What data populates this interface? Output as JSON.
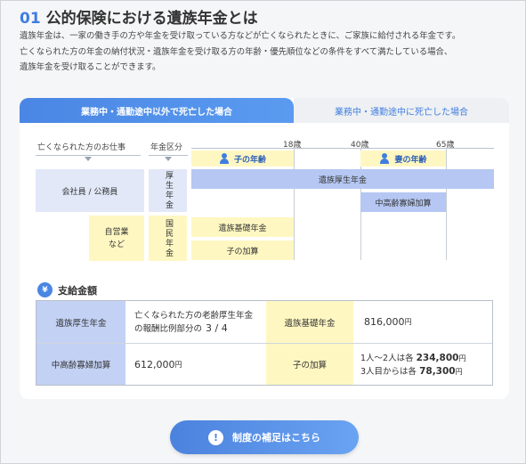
{
  "section": {
    "number": "01",
    "title": "公的保険における遺族年金とは",
    "intro_lines": [
      "遺族年金は、一家の働き手の方や年金を受け取っている方などが亡くなられたときに、ご家族に給付される年金です。",
      "亡くなられた方の年金の納付状況・遺族年金を受け取る方の年齢・優先順位などの条件をすべて満たしている場合、",
      "遺族年金を受け取ることができます。"
    ]
  },
  "tabs": [
    {
      "label": "業務中・通勤途中以外で死亡した場合",
      "active": true
    },
    {
      "label": "業務中・通勤途中に死亡した場合",
      "active": false
    }
  ],
  "diagram": {
    "col_occupation": "亡くなられた方のお仕事",
    "col_pension_type": "年金区分",
    "ages": [
      "18歳",
      "40歳",
      "65歳"
    ],
    "child_age_label": "子の年齢",
    "wife_age_label": "妻の年齢",
    "employee": "会社員 / 公務員",
    "self_employed": "自営業など",
    "kosei": "厚生年金",
    "kokumin": "国民年金",
    "bars": {
      "izoku_kosei": "遺族厚生年金",
      "chukorei": "中高齢寡婦加算",
      "izoku_kiso": "遺族基礎年金",
      "ko_kasan": "子の加算"
    }
  },
  "payment": {
    "title": "支給金額",
    "yen_icon": "¥",
    "rows": [
      {
        "h1": "遺族厚生年金",
        "v1_line1": "亡くなられた方の老齢厚生年金",
        "v1_line2": "の報酬比例部分の",
        "v1_fraction": "3 / 4",
        "h2": "遺族基礎年金",
        "v2_amount": "816,000",
        "v2_unit": "円"
      },
      {
        "h1": "中高齢寡婦加算",
        "v1_amount": "612,000",
        "v1_unit": "円",
        "h2": "子の加算",
        "v2_line1_prefix": "1人～2人は各",
        "v2_line1_amount": "234,800",
        "v2_line2_prefix": "3人目からは各",
        "v2_line2_amount": "78,300",
        "v2_unit": "円"
      }
    ]
  },
  "cta": {
    "label": "制度の補足はこちら",
    "icon": "!"
  }
}
